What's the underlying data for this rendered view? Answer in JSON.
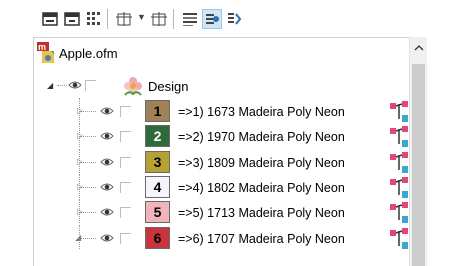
{
  "toolbar": {
    "buttons": [
      {
        "icon": "expand-all-icon"
      },
      {
        "icon": "collapse-all-icon"
      },
      {
        "icon": "grid-view-icon"
      },
      {
        "icon": "filter-icon"
      },
      {
        "icon": "filter-alt-icon"
      },
      {
        "icon": "list-view-icon"
      },
      {
        "icon": "show-visibility-icon",
        "active": true
      },
      {
        "icon": "thread-sequence-icon"
      }
    ]
  },
  "tree": {
    "file": {
      "name": "Apple.ofm",
      "icon": "embroidery-file-icon"
    },
    "design": {
      "name": "Design",
      "icon": "design-flower-icon"
    },
    "threads": [
      {
        "num": "1",
        "label": "=>1) 1673 Madeira Poly Neon",
        "color": "#a08158",
        "text_color": "#000000"
      },
      {
        "num": "2",
        "label": "=>2) 1970 Madeira Poly Neon",
        "color": "#2f6a3a",
        "text_color": "#ffffff"
      },
      {
        "num": "3",
        "label": "=>3) 1809 Madeira Poly Neon",
        "color": "#b6a134",
        "text_color": "#000000"
      },
      {
        "num": "4",
        "label": "=>4) 1802 Madeira Poly Neon",
        "color": "#f5f5fb",
        "text_color": "#000000"
      },
      {
        "num": "5",
        "label": "=>5) 1713 Madeira Poly Neon",
        "color": "#f3b3ba",
        "text_color": "#000000"
      },
      {
        "num": "6",
        "label": "=>6) 1707 Madeira Poly Neon",
        "color": "#c8343c",
        "text_color": "#000000"
      }
    ]
  }
}
